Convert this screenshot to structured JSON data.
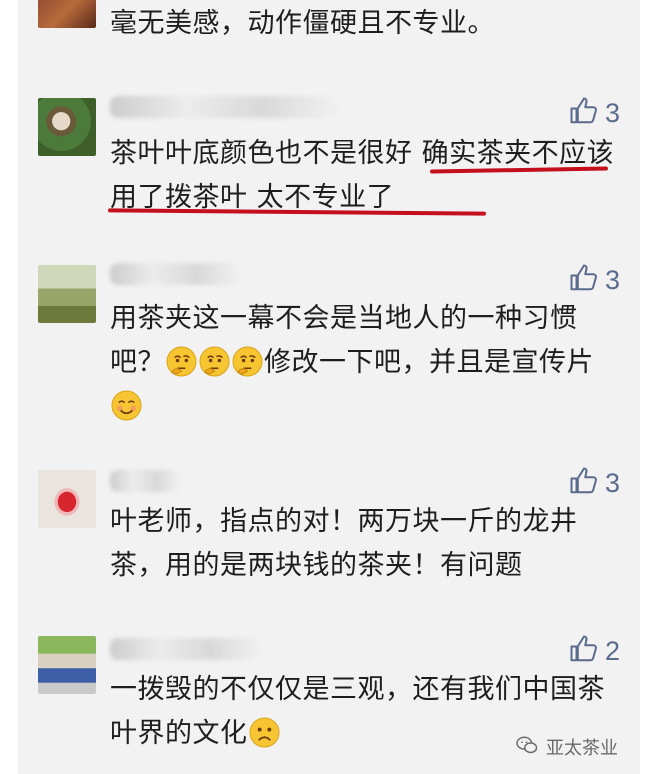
{
  "comments": [
    {
      "text": "毫无美感，动作僵硬且不专业。"
    },
    {
      "likes": "3",
      "text": "茶叶叶底颜色也不是很好 确实茶夹不应该用了拨茶叶 太不专业了"
    },
    {
      "likes": "3",
      "text_a": "用茶夹这一幕不会是当地人的一种习惯吧？",
      "text_b": "修改一下吧，并且是宣传片"
    },
    {
      "likes": "3",
      "text": "叶老师，指点的对！两万块一斤的龙井茶，用的是两块钱的茶夹！有问题"
    },
    {
      "likes": "2",
      "text": "一拨毁的不仅仅是三观，还有我们中国茶叶界的文化"
    }
  ],
  "watermark": {
    "label": "亚太茶业"
  },
  "icons": {
    "like": "thumbs-up-icon",
    "watermark": "wechat-icon"
  },
  "colors": {
    "like": "#5b6b8e",
    "underline": "#c4101c"
  }
}
